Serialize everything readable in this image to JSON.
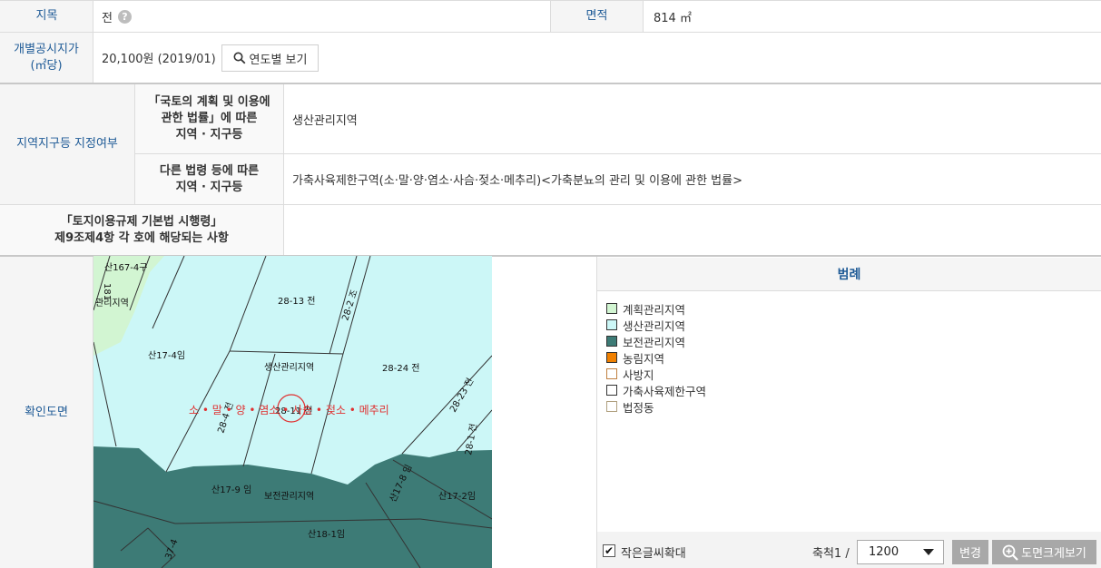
{
  "row1": {
    "jimok_label": "지목",
    "jimok_value": "전",
    "help_glyph": "?",
    "area_label": "면적",
    "area_value": "814 ㎡"
  },
  "row2": {
    "price_label_line1": "개별공시지가",
    "price_label_line2": "(㎡당)",
    "price_value": "20,100원 (2019/01)",
    "year_button": "연도별 보기"
  },
  "zone": {
    "section_label": "지역지구등 지정여부",
    "sub1_line1": "「국토의 계획 및 이용에",
    "sub1_line2": "관한 법률」에 따른",
    "sub1_line3": "지역 · 지구등",
    "sub1_value": "생산관리지역",
    "sub2_line1": "다른 법령 등에 따른",
    "sub2_line2": "지역 · 지구등",
    "sub2_value": "가축사육제한구역(소·말·양·염소·사슴·젖소·메추리)<가축분뇨의 관리 및 이용에 관한 법률>"
  },
  "rule": {
    "line1": "「토지이용규제 기본법 시행령」",
    "line2": "제9조제4항 각 호에 해당되는 사항",
    "value": ""
  },
  "map_section": {
    "label": "확인도면",
    "labels": {
      "p1": "산167-4구",
      "p2": "28-13 전",
      "p3": "28-2 조",
      "p4": "산17-4임",
      "p5": "생산관리지역",
      "p6": "28-24 전",
      "p7": "28-23 전",
      "p8": "28-4 전",
      "p9": "28-11 전",
      "p10": "28-1 전",
      "p11": "산17-9 임",
      "p12": "보전관리지역",
      "p13": "산17-8 임",
      "p14": "산17-2임",
      "p15": "산18-1임",
      "p16": "37-4",
      "p17": "181",
      "p18": "관리지역",
      "overlay": "소 • 말 • 양 • 염소 • 사슴 • 젖소 • 메추리"
    },
    "colors": {
      "production": "#ccf7f7",
      "conservation": "#3d7b76",
      "planning": "#d2f5d2",
      "overlay_red": "#e03030"
    }
  },
  "legend": {
    "title": "범례",
    "items": [
      {
        "label": "계획관리지역",
        "color": "#d2f5d2",
        "border": "#333333"
      },
      {
        "label": "생산관리지역",
        "color": "#ccf7f7",
        "border": "#333333"
      },
      {
        "label": "보전관리지역",
        "color": "#3d7b76",
        "border": "#333333"
      },
      {
        "label": "농림지역",
        "color": "#f08000",
        "border": "#333333"
      },
      {
        "label": "사방지",
        "color": "#ffffff",
        "border": "#c08040"
      },
      {
        "label": "가축사육제한구역",
        "color": "#ffffff",
        "border": "#333333"
      },
      {
        "label": "법정동",
        "color": "#ffffff",
        "border": "#b0a080"
      }
    ]
  },
  "controls": {
    "enlarge_text_label": "작은글씨확대",
    "enlarge_checked": "✔",
    "scale_label": "축척1 /",
    "scale_value": "1200",
    "change_button": "변경",
    "big_map_button": "도면크게보기"
  }
}
